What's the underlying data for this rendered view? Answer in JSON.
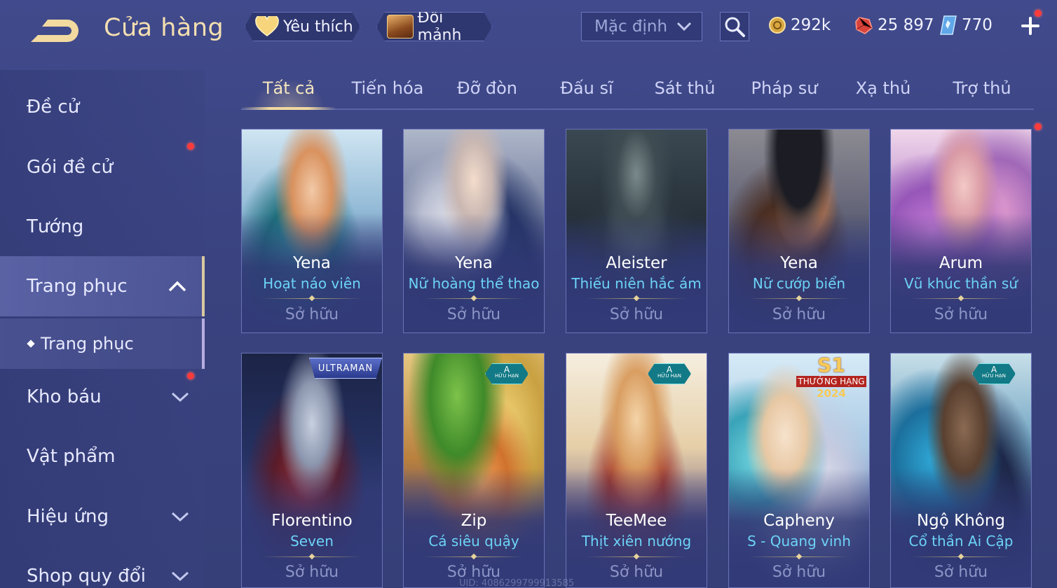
{
  "header": {
    "title": "Cửa hàng",
    "favorites_label": "Yêu thích",
    "exchange_label": "Đổi mảnh",
    "sort_value": "Mặc định",
    "currencies": [
      {
        "icon": "gold-coin-icon",
        "value": "292k"
      },
      {
        "icon": "ruby-icon",
        "value": "25 897"
      },
      {
        "icon": "crystal-voucher-icon",
        "value": "770"
      }
    ]
  },
  "sidebar": {
    "items": [
      {
        "label": "Đề cử"
      },
      {
        "label": "Gói đề cử"
      },
      {
        "label": "Tướng"
      },
      {
        "label": "Trang phục"
      },
      {
        "label": "Trang phục"
      },
      {
        "label": "Kho báu"
      },
      {
        "label": "Vật phẩm"
      },
      {
        "label": "Hiệu ứng"
      },
      {
        "label": "Shop quy đổi"
      }
    ]
  },
  "tabs": [
    "Tất cả",
    "Tiến hóa",
    "Đỡ đòn",
    "Đấu sĩ",
    "Sát thủ",
    "Pháp sư",
    "Xạ thủ",
    "Trợ thủ"
  ],
  "active_tab": "Tất cả",
  "skins": [
    {
      "hero": "Yena",
      "skin": "Hoạt náo viên",
      "status": "Sở hữu"
    },
    {
      "hero": "Yena",
      "skin": "Nữ hoàng thể thao",
      "status": "Sở hữu"
    },
    {
      "hero": "Aleister",
      "skin": "Thiếu niên hắc ám",
      "status": "Sở hữu"
    },
    {
      "hero": "Yena",
      "skin": "Nữ cướp biển",
      "status": "Sở hữu"
    },
    {
      "hero": "Arum",
      "skin": "Vũ khúc thần sứ",
      "status": "Sở hữu"
    },
    {
      "hero": "Florentino",
      "skin": "Seven",
      "status": "Sở hữu",
      "badge": "ULTRAMAN"
    },
    {
      "hero": "Zip",
      "skin": "Cá siêu quậy",
      "status": "Sở hữu",
      "badge": "A",
      "badge_sub": "HỮU HẠN"
    },
    {
      "hero": "TeeMee",
      "skin": "Thịt xiên nướng",
      "status": "Sở hữu",
      "badge": "A",
      "badge_sub": "HỮU HẠN"
    },
    {
      "hero": "Capheny",
      "skin": "S - Quang vinh",
      "status": "Sở hữu",
      "badge": "S1",
      "badge_sub": "THƯỞNG HẠNG",
      "badge_year": "2024"
    },
    {
      "hero": "Ngộ Không",
      "skin": "Cổ thần Ai Cập",
      "status": "Sở hữu",
      "badge": "A",
      "badge_sub": "HỮU HẠN"
    }
  ],
  "uid_text": "UID: 4086299799913585",
  "colors": {
    "background": "#3b4482",
    "title_gold": "#f3dfb0",
    "skin_name_cyan": "#6cd3f7",
    "owned_gray": "#8d94c6",
    "notification_red": "#ff3b3b"
  }
}
